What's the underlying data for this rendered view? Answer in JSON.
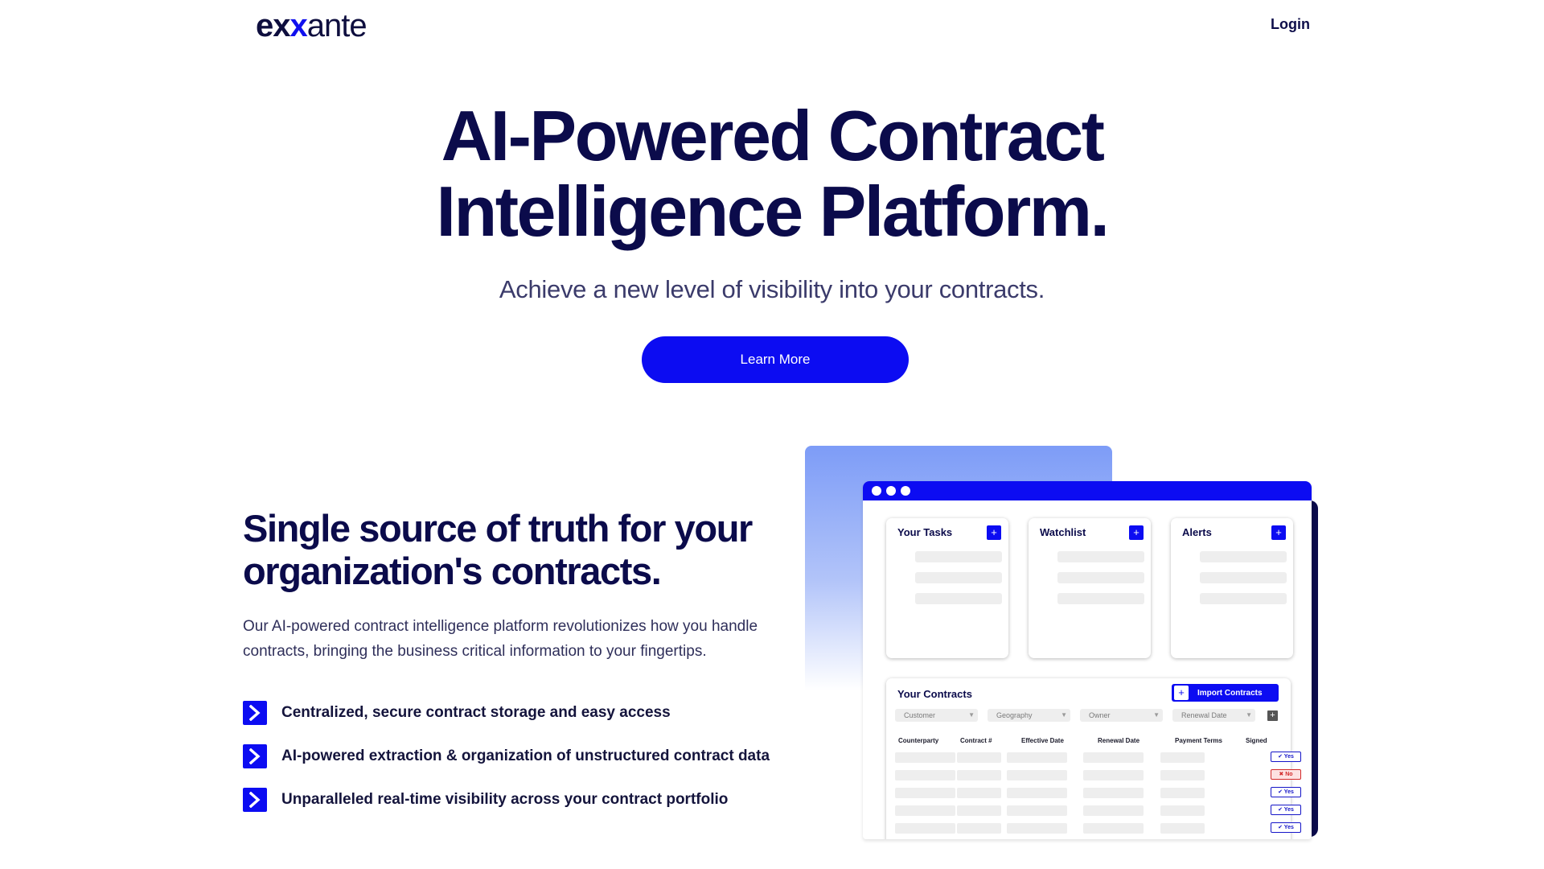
{
  "header": {
    "logo": {
      "part1": "ex",
      "part2": "x",
      "part3": "ante"
    },
    "login_label": "Login"
  },
  "hero": {
    "title_line1": "AI-Powered Contract",
    "title_line2": "Intelligence Platform.",
    "subtitle": "Achieve a new level of visibility into your contracts.",
    "cta_label": "Learn More"
  },
  "features": {
    "title_line1": "Single source of truth for your",
    "title_line2": "organization's contracts.",
    "body": "Our AI-powered contract intelligence platform revolutionizes how you handle contracts, bringing the business critical information to your fingertips.",
    "bullets": [
      "Centralized, secure contract storage and easy access",
      "AI-powered extraction & organization of unstructured contract data",
      "Unparalleled real-time visibility across your contract portfolio"
    ]
  },
  "mockup": {
    "cards": [
      "Your Tasks",
      "Watchlist",
      "Alerts"
    ],
    "plus_symbol": "+",
    "contracts": {
      "title": "Your Contracts",
      "import_label": "Import Contracts",
      "filters": [
        "Customer",
        "Geography",
        "Owner",
        "Renewal Date"
      ],
      "columns": [
        "Counterparty",
        "Contract #",
        "Effective Date",
        "Renewal Date",
        "Payment Terms",
        "Signed"
      ],
      "signed": [
        "✔ Yes",
        "✖ No",
        "✔ Yes",
        "✔ Yes",
        "✔ Yes"
      ]
    }
  },
  "colors": {
    "brand_blue": "#0c0cf2",
    "navy": "#0b0b4b",
    "no_red": "#d22a2a"
  }
}
